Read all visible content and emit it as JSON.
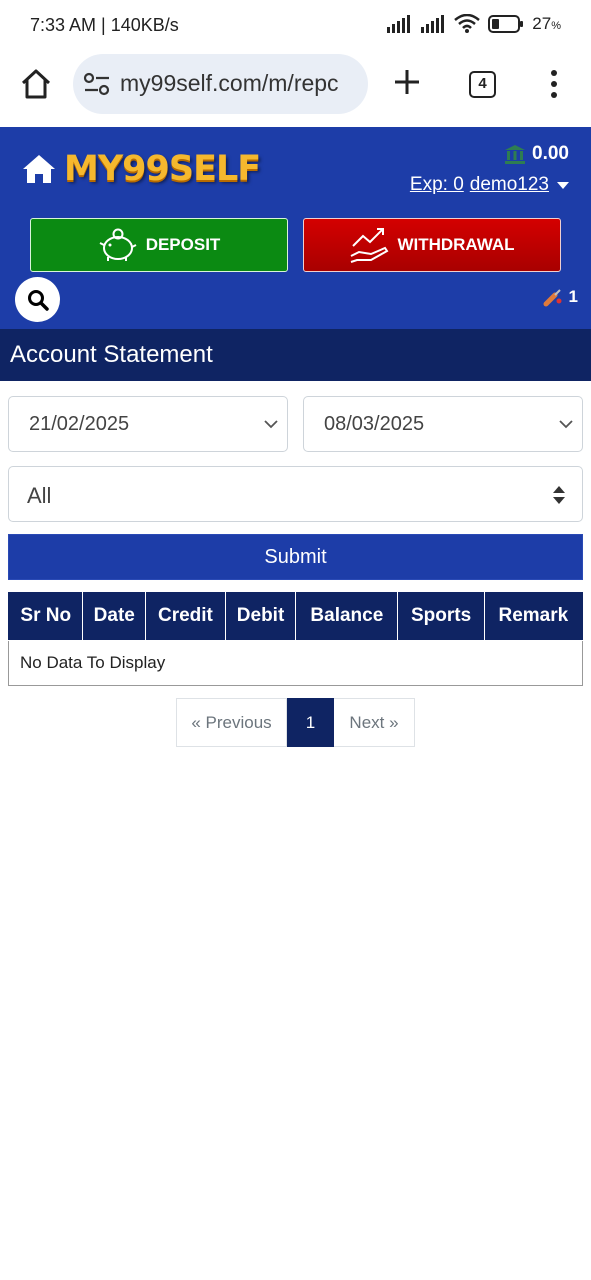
{
  "status_bar": {
    "time": "7:33 AM | 140KB/s",
    "battery_percent": "27",
    "battery_unit": "%",
    "icons": [
      "signal-icon",
      "signal-icon",
      "wifi-icon",
      "battery-icon"
    ]
  },
  "browser": {
    "url": "my99self.com/m/repc",
    "tab_count": "4"
  },
  "header": {
    "logo_text": "MY99SELF",
    "balance": "0.00",
    "exp_label": "Exp: 0",
    "username": "demo123",
    "deposit_label": "DEPOSIT",
    "withdrawal_label": "WITHDRAWAL",
    "open_bets_count": "1",
    "colors": {
      "header_bg": "#1d3da8",
      "deposit": "#0b8a12",
      "withdrawal": "#c40000",
      "title_bg": "#0f2463"
    }
  },
  "page": {
    "title": "Account Statement"
  },
  "filters": {
    "from_date": "21/02/2025",
    "to_date": "08/03/2025",
    "type": "All",
    "submit_label": "Submit"
  },
  "table": {
    "columns": [
      "Sr No",
      "Date",
      "Credit",
      "Debit",
      "Balance",
      "Sports",
      "Remark"
    ],
    "empty_message": "No Data To Display"
  },
  "pagination": {
    "previous_label": "« Previous",
    "current_page": "1",
    "next_label": "Next »"
  }
}
